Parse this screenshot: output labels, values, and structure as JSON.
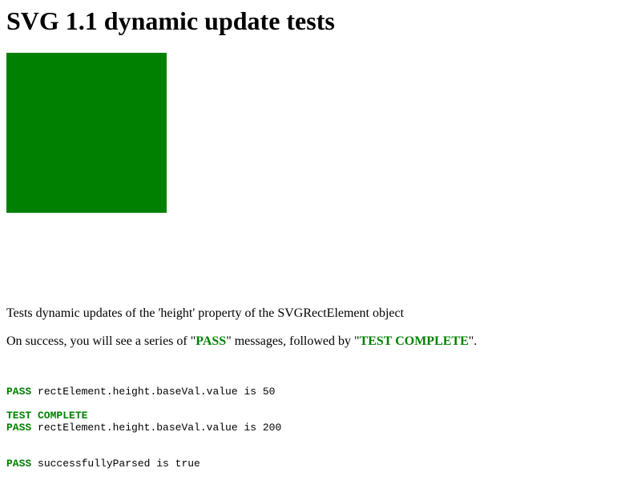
{
  "page": {
    "title": "SVG 1.1 dynamic update tests"
  },
  "colors": {
    "pass": "#008000",
    "rect_fill": "#008000",
    "text": "#000000",
    "background": "#ffffff"
  },
  "svg": {
    "rect_fill_name": "green"
  },
  "description": "Tests dynamic updates of the 'height' property of the SVGRectElement object",
  "instructions": {
    "prefix": "On success, you will see a series of \"",
    "pass_word": "PASS",
    "middle": "\" messages, followed by \"",
    "complete_word": "TEST COMPLETE",
    "suffix": "\"."
  },
  "console": {
    "lines": [
      {
        "status": "PASS",
        "message": " rectElement.height.baseVal.value is 50"
      },
      {
        "status": "PASS",
        "message": " rectElement.height.baseVal.value is 200"
      },
      {
        "status": "PASS",
        "message": " successfullyParsed is true"
      }
    ],
    "complete_label": "TEST COMPLETE"
  }
}
